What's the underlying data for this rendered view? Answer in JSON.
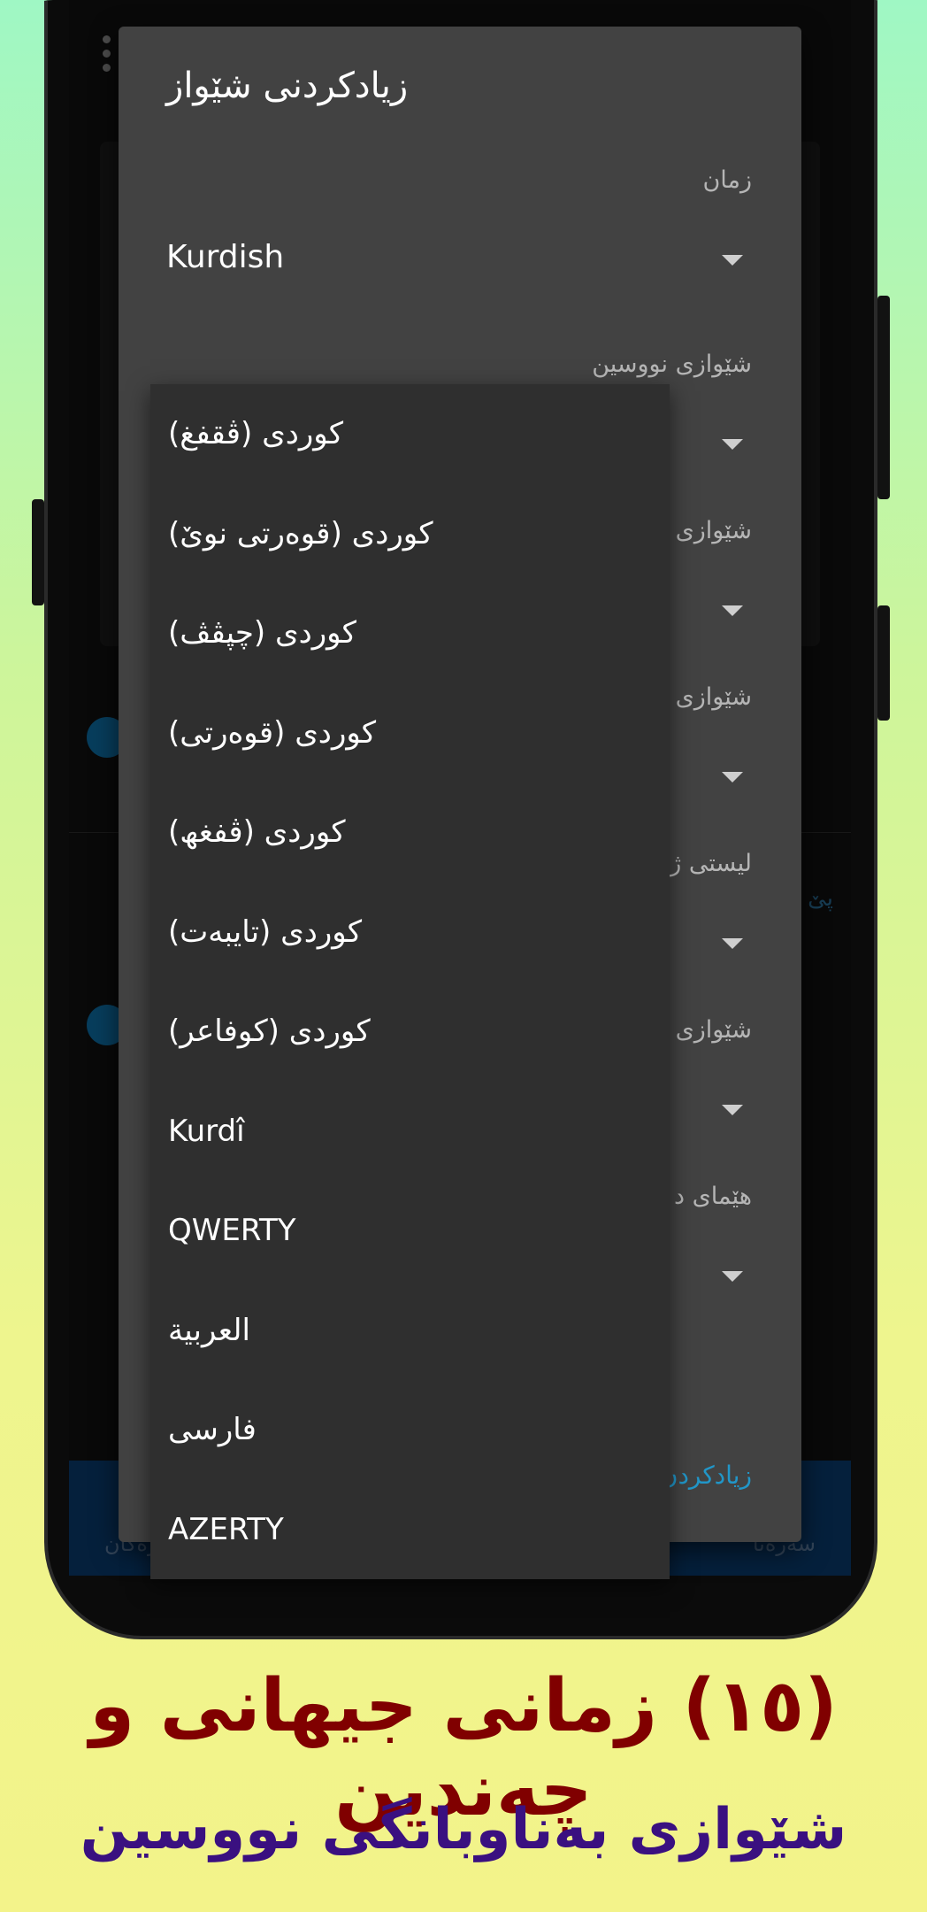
{
  "dialog": {
    "title": "زیادکردنی شێواز",
    "language_label": "زمان",
    "language_value": "Kurdish",
    "layout_label": "شێوازی نووسین",
    "field3_label": "شێوازی",
    "field4_label": "شێوازی",
    "field5_label": "لیستی ژ",
    "field6_label": "شێوازی",
    "field7_label": "هێمای د",
    "add_label": "زیادکردن"
  },
  "dropdown": {
    "items": [
      "کوردی (ڤقفغ)",
      "کوردی (قوەرتی نوێ)",
      "کوردی (چپڤڤ)",
      "کوردی (قوەرتی)",
      "کوردی (ڤفغھ)",
      "کوردی (تایبەت)",
      "کوردی (کوفاعر)",
      "Kurdî",
      "QWERTY",
      "العربية",
      "فارسی",
      "AZERTY"
    ]
  },
  "background": {
    "bottom_left": "پەرەکان",
    "bottom_right": "سەرەتا",
    "link_text": "پێ"
  },
  "caption": {
    "title": "(١٥) زمانی جیهانی و چەندین",
    "subtitle": "شێوازی بەناوبانگی نووسین"
  },
  "colors": {
    "dialog_bg": "#424242",
    "dropdown_bg": "#2f2f2f",
    "accent": "#2196c8",
    "caption_title": "#800000",
    "caption_subtitle": "#3a1080"
  }
}
